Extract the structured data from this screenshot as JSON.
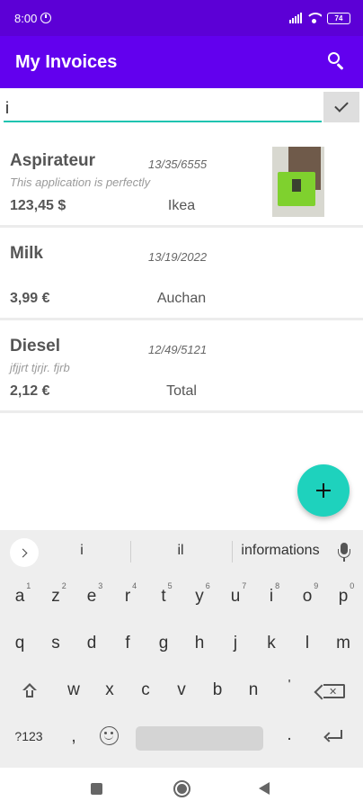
{
  "status_bar": {
    "time": "8:00",
    "battery": "74"
  },
  "app_bar": {
    "title": "My Invoices"
  },
  "search": {
    "value": "i"
  },
  "invoices": [
    {
      "title": "Aspirateur",
      "date": "13/35/6555",
      "description": "This application is perfectly",
      "amount": "123,45 $",
      "store": "Ikea",
      "has_thumbnail": true
    },
    {
      "title": "Milk",
      "date": "13/19/2022",
      "description": "",
      "amount": "3,99 €",
      "store": "Auchan",
      "has_thumbnail": false
    },
    {
      "title": "Diesel",
      "date": "12/49/5121",
      "description": "jfjjrt tjrjr. fjrb",
      "amount": "2,12 €",
      "store": "Total",
      "has_thumbnail": false
    }
  ],
  "fab": {
    "icon": "plus-icon"
  },
  "keyboard": {
    "suggestions": [
      "i",
      "il",
      "informations"
    ],
    "row1": [
      {
        "key": "a",
        "hint": "1"
      },
      {
        "key": "z",
        "hint": "2"
      },
      {
        "key": "e",
        "hint": "3"
      },
      {
        "key": "r",
        "hint": "4"
      },
      {
        "key": "t",
        "hint": "5"
      },
      {
        "key": "y",
        "hint": "6"
      },
      {
        "key": "u",
        "hint": "7"
      },
      {
        "key": "i",
        "hint": "8"
      },
      {
        "key": "o",
        "hint": "9"
      },
      {
        "key": "p",
        "hint": "0"
      }
    ],
    "row2": [
      "q",
      "s",
      "d",
      "f",
      "g",
      "h",
      "j",
      "k",
      "l",
      "m"
    ],
    "row3": [
      "w",
      "x",
      "c",
      "v",
      "b",
      "n",
      "'"
    ],
    "row4": {
      "symbols": "?123",
      "comma": ",",
      "period": "."
    }
  },
  "colors": {
    "status_bar": "#5c00d6",
    "app_bar": "#6200ee",
    "accent": "#1ed2bd",
    "input_underline": "#1fc4b0"
  }
}
